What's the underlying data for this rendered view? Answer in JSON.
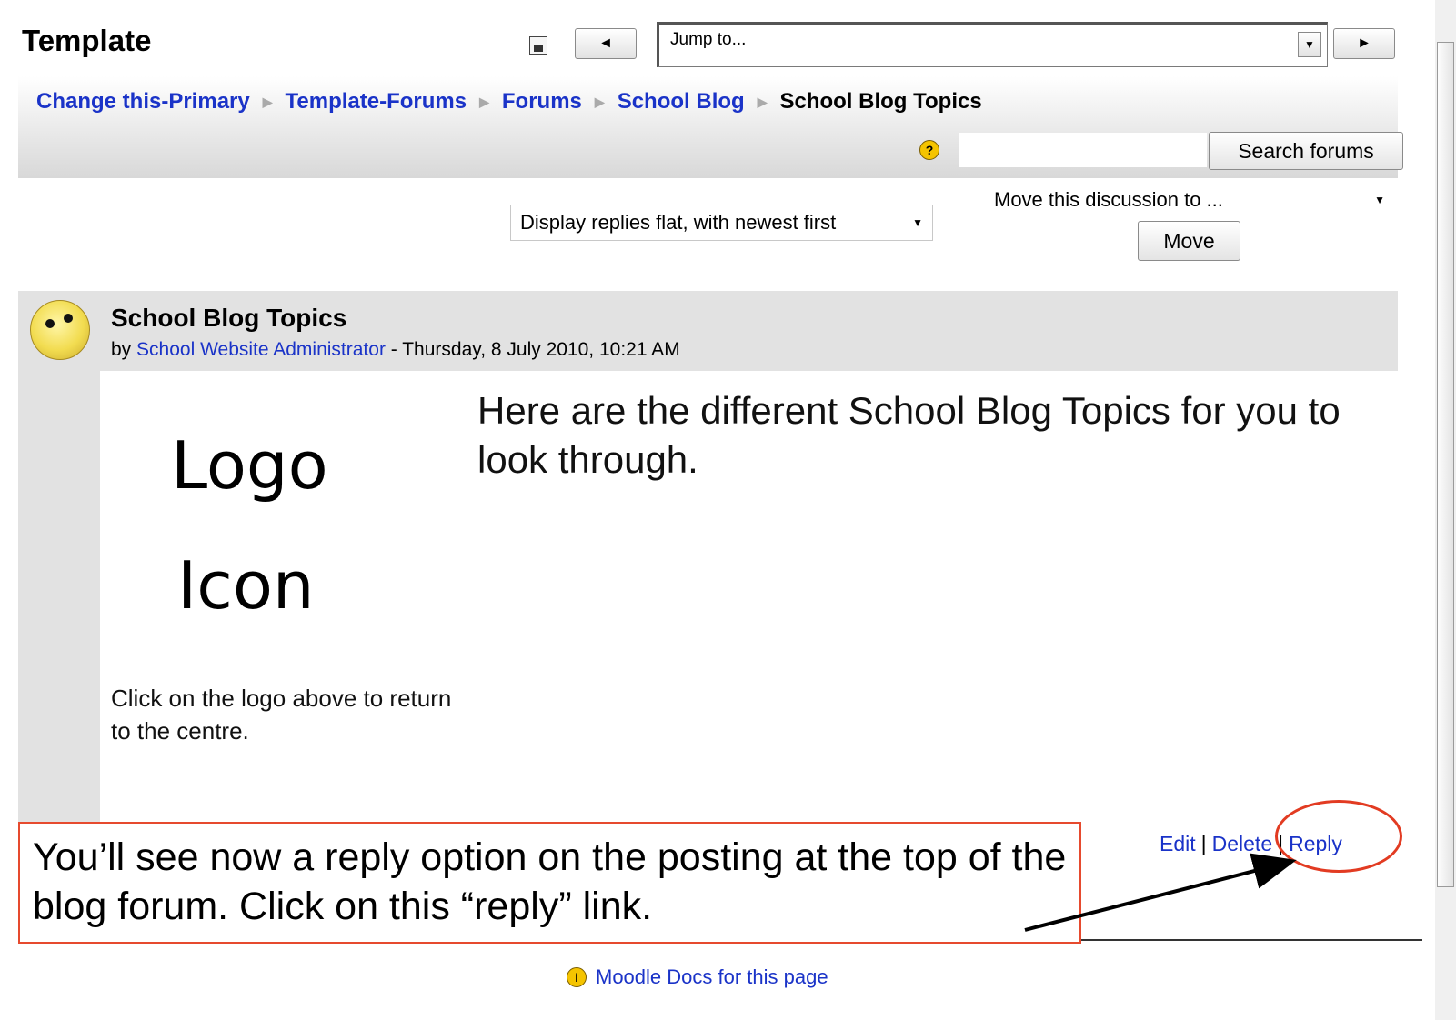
{
  "header": {
    "title": "Template",
    "jump_placeholder": "Jump to...",
    "prev_icon": "◄",
    "next_icon": "►",
    "dropdown_icon": "▼"
  },
  "breadcrumb": {
    "items": [
      "Change this-Primary",
      "Template-Forums",
      "Forums",
      "School Blog"
    ],
    "current": "School Blog Topics",
    "separator": "▶"
  },
  "search": {
    "help_icon": "?",
    "value": "",
    "button_label": "Search forums"
  },
  "controls": {
    "display_mode": "Display replies flat, with newest first",
    "move_to": "Move this discussion to ...",
    "move_button": "Move"
  },
  "post": {
    "subject": "School Blog Topics",
    "by": "by",
    "author": "School Website Administrator",
    "date": "- Thursday, 8 July 2010, 10:21 AM",
    "logo_line1": "Logo",
    "logo_line2": "Icon",
    "logo_caption": "Click on the logo above to return to the centre.",
    "body": "Here are the different School Blog Topics for you to look through.",
    "actions": {
      "edit": "Edit",
      "delete": "Delete",
      "reply": "Reply",
      "separator": "|"
    }
  },
  "footer": {
    "info_icon": "i",
    "docs_link": "Moodle Docs for this page"
  },
  "annotation": {
    "callout_text": "You’ll see now a reply option on the posting at the top of the blog forum. Click on this “reply” link.",
    "highlight_color": "#e23b22"
  },
  "colors": {
    "link": "#1a33c8",
    "header_band": "#e2e2e2"
  }
}
